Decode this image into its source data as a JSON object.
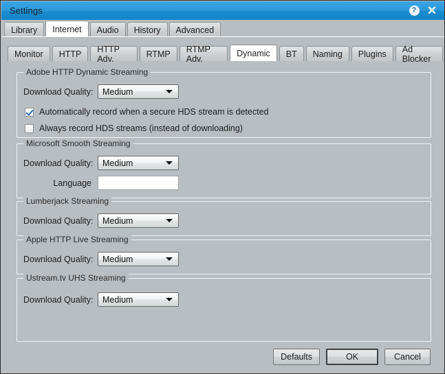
{
  "window": {
    "title": "Settings",
    "help_icon_label": "?",
    "close_icon_label": "✕"
  },
  "main_tabs": [
    {
      "label": "Library",
      "selected": false
    },
    {
      "label": "Internet",
      "selected": true
    },
    {
      "label": "Audio",
      "selected": false
    },
    {
      "label": "History",
      "selected": false
    },
    {
      "label": "Advanced",
      "selected": false
    }
  ],
  "sub_tabs": [
    {
      "label": "Monitor",
      "selected": false
    },
    {
      "label": "HTTP",
      "selected": false
    },
    {
      "label": "HTTP Adv.",
      "selected": false
    },
    {
      "label": "RTMP",
      "selected": false
    },
    {
      "label": "RTMP Adv.",
      "selected": false
    },
    {
      "label": "Dynamic",
      "selected": true
    },
    {
      "label": "BT",
      "selected": false
    },
    {
      "label": "Naming",
      "selected": false
    },
    {
      "label": "Plugins",
      "selected": false
    },
    {
      "label": "Ad Blocker",
      "selected": false
    }
  ],
  "groups": {
    "adobe": {
      "title": "Adobe HTTP Dynamic Streaming",
      "quality_label": "Download Quality:",
      "quality_value": "Medium",
      "checkbox_auto_record": {
        "label": "Automatically record when a secure HDS stream is detected",
        "checked": true
      },
      "checkbox_always_record": {
        "label": "Always record HDS streams (instead of downloading)",
        "checked": false
      }
    },
    "smooth": {
      "title": "Microsoft Smooth Streaming",
      "quality_label": "Download Quality:",
      "quality_value": "Medium",
      "language_label": "Language",
      "language_value": "",
      "language_placeholder": ""
    },
    "lumberjack": {
      "title": "Lumberjack Streaming",
      "quality_label": "Download Quality:",
      "quality_value": "Medium"
    },
    "apple": {
      "title": "Apple HTTP Live Streaming",
      "quality_label": "Download Quality:",
      "quality_value": "Medium"
    },
    "ustream": {
      "title": "Ustream.tv UHS Streaming",
      "quality_label": "Download Quality:",
      "quality_value": "Medium"
    }
  },
  "footer": {
    "defaults_label": "Defaults",
    "ok_label": "OK",
    "cancel_label": "Cancel"
  },
  "colors": {
    "titlebar_blue": "#2e9bdd",
    "window_bg": "#b9bec2",
    "selected_tab": "#ffffff",
    "check_blue": "#2f6fb5"
  }
}
